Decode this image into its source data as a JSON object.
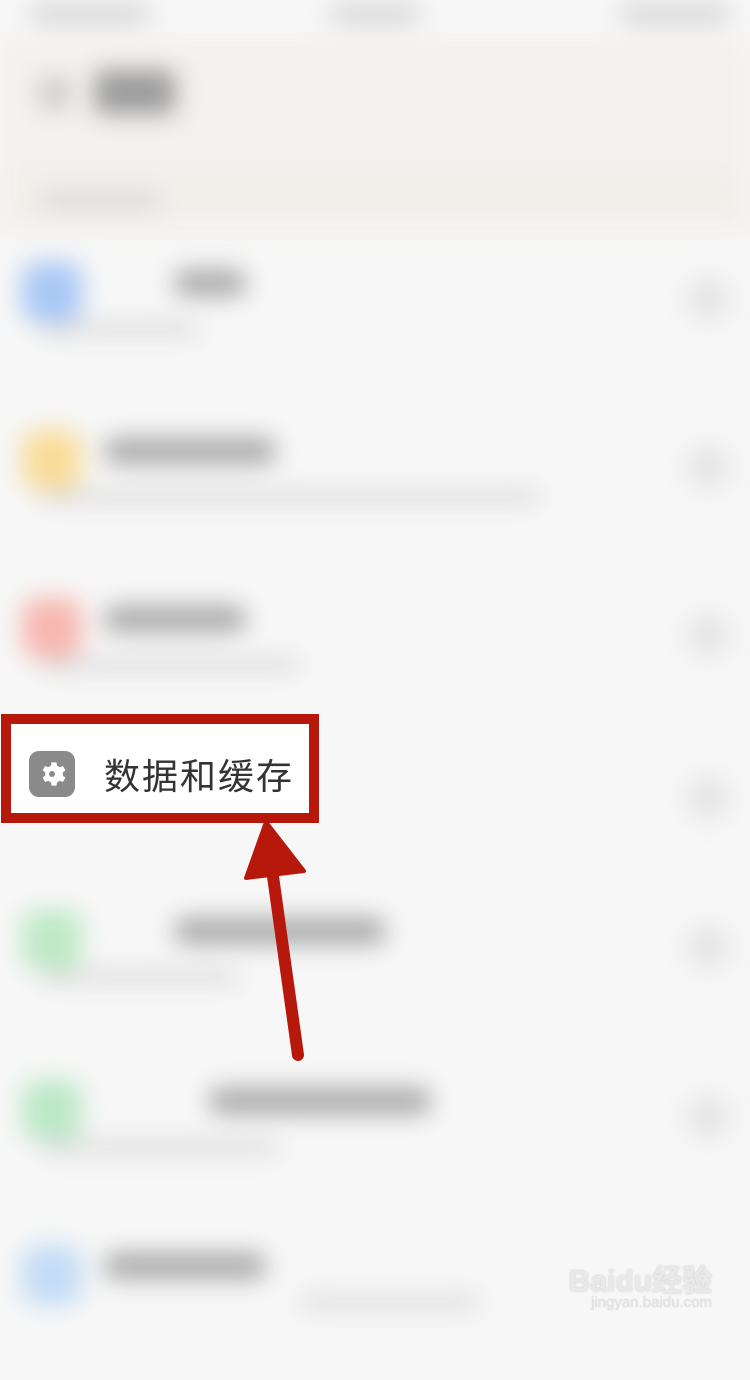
{
  "highlighted_item": {
    "label": "数据和缓存",
    "icon": "gear-icon"
  },
  "colors": {
    "highlight_border": "#b7180c",
    "arrow": "#b7180c",
    "icon_badge": "#8a8a8a",
    "list_icons": [
      "#a9c8f5",
      "#f9dc9a",
      "#f7b7b0",
      "#bfe9c6",
      "#bce8c7",
      "#c3dcf6"
    ]
  },
  "watermark": {
    "logo": "Baidu经验",
    "url": "jingyan.baidu.com"
  }
}
